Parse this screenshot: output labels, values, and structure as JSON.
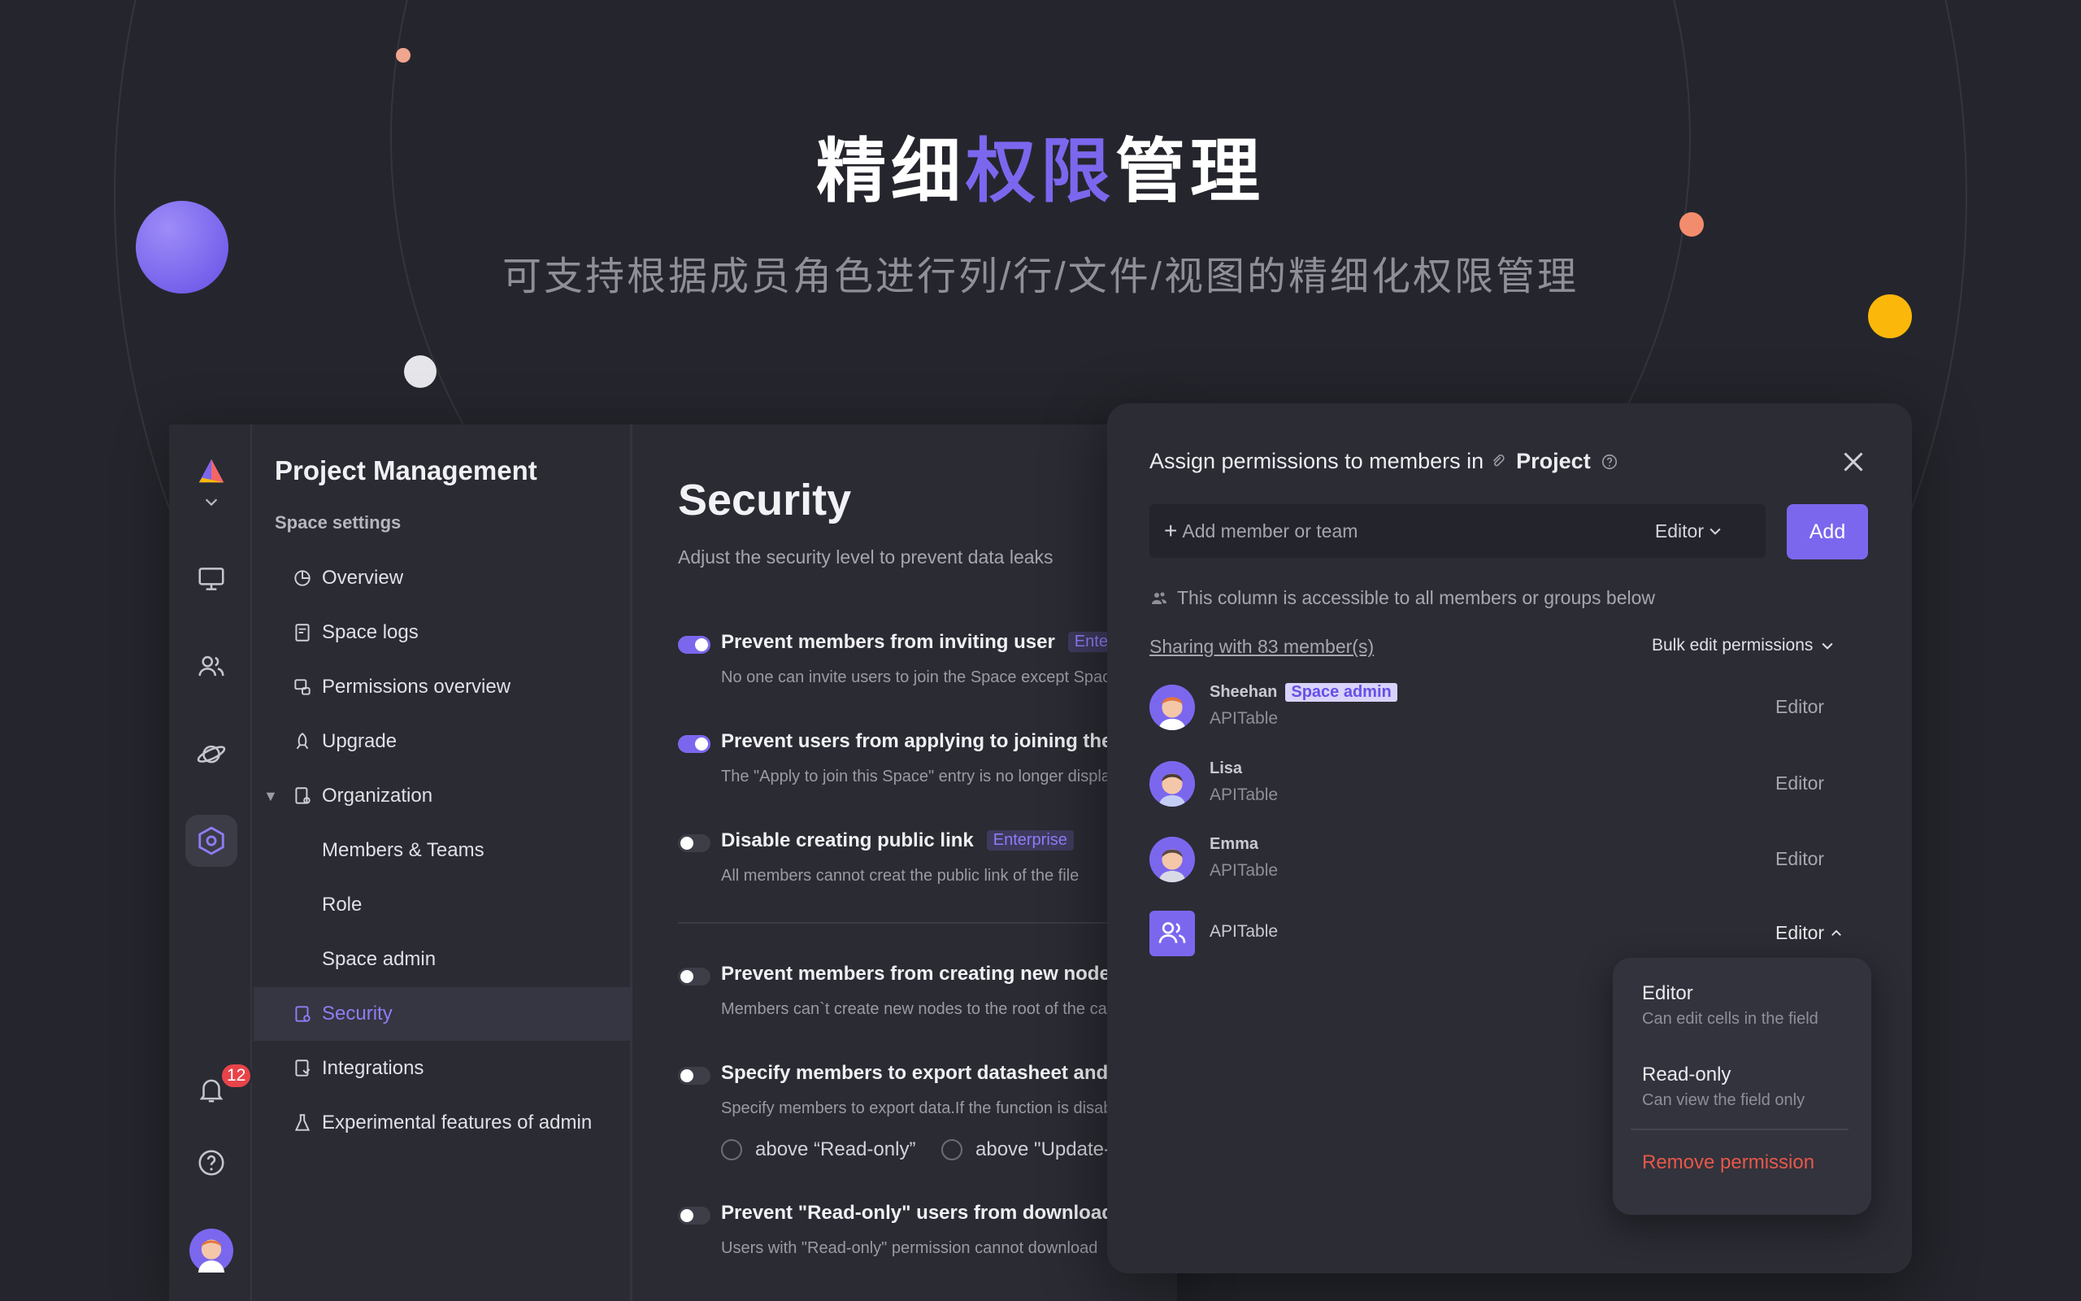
{
  "hero": {
    "title_before": "精细",
    "title_highlight": "权限",
    "title_after": "管理",
    "subtitle": "可支持根据成员角色进行列/行/文件/视图的精细化权限管理"
  },
  "colors": {
    "background": "#25262d",
    "accent": "#7b67ee",
    "danger": "#e8574a",
    "badge": "#e8434a"
  },
  "rail": {
    "icons": [
      "logo-icon",
      "chevron-down-icon",
      "monitor-icon",
      "members-icon",
      "planet-icon",
      "settings-hex-icon",
      "bell-icon",
      "help-icon",
      "user-avatar"
    ],
    "notification_count": "12"
  },
  "nav": {
    "title": "Project Management",
    "section": "Space settings",
    "items": [
      {
        "label": "Overview",
        "icon": "pie-chart-icon"
      },
      {
        "label": "Space logs",
        "icon": "log-icon"
      },
      {
        "label": "Permissions overview",
        "icon": "permissions-icon"
      },
      {
        "label": "Upgrade",
        "icon": "rocket-icon"
      },
      {
        "label": "Organization",
        "icon": "org-icon"
      },
      {
        "label": "Members & Teams",
        "icon": ""
      },
      {
        "label": "Role",
        "icon": ""
      },
      {
        "label": "Space admin",
        "icon": ""
      },
      {
        "label": "Security",
        "icon": "security-icon"
      },
      {
        "label": "Integrations",
        "icon": "integrations-icon"
      },
      {
        "label": "Experimental features of admin",
        "icon": "flask-icon"
      }
    ]
  },
  "security": {
    "title": "Security",
    "description": "Adjust the security level to prevent data leaks",
    "enterprise_tag": "Enterprise",
    "options": [
      {
        "label": "Prevent members from inviting user",
        "desc": "No one can invite users to join the Space except Space admins",
        "on": true,
        "tag": "Enterprise"
      },
      {
        "label": "Prevent users from applying to joining the Space",
        "desc": "The \"Apply to join this Space\" entry is no longer displayed",
        "on": true,
        "tag": ""
      },
      {
        "label": "Disable creating public link",
        "desc": "All members cannot creat the public link of the file",
        "on": false,
        "tag": "Enterprise"
      },
      {
        "label": "Prevent members from creating new nodes",
        "desc": "Members can`t create new nodes to the root of the catalog",
        "on": false,
        "tag": ""
      },
      {
        "label": "Specify members to export datasheet and view",
        "desc": "Specify members to export data.If the function is disabled",
        "on": false,
        "tag": ""
      },
      {
        "label": "Prevent \"Read-only\" users from downloading",
        "desc": "Users with \"Read-only\" permission cannot download",
        "on": false,
        "tag": ""
      }
    ],
    "radios": [
      "above “Read-only”",
      "above \"Update-only\""
    ]
  },
  "panel": {
    "title_prefix": "Assign permissions to members in",
    "node_name": "Project",
    "input_placeholder": "Add member or team",
    "input_role": "Editor",
    "add_label": "Add",
    "info": "This column is accessible to all members or groups below",
    "sharing": "Sharing with 83 member(s)",
    "bulk": "Bulk edit permissions",
    "members": [
      {
        "name": "Sheehan",
        "org": "APITable",
        "role": "Editor",
        "tag": "Space admin"
      },
      {
        "name": "Lisa",
        "org": "APITable",
        "role": "Editor",
        "tag": ""
      },
      {
        "name": "Emma",
        "org": "APITable",
        "role": "Editor",
        "tag": ""
      },
      {
        "name": "",
        "org": "APITable",
        "role": "Editor",
        "tag": ""
      }
    ],
    "dropdown": {
      "editor_title": "Editor",
      "editor_desc": "Can edit cells in the field",
      "readonly_title": "Read-only",
      "readonly_desc": "Can view the field only",
      "remove": "Remove permission"
    }
  }
}
